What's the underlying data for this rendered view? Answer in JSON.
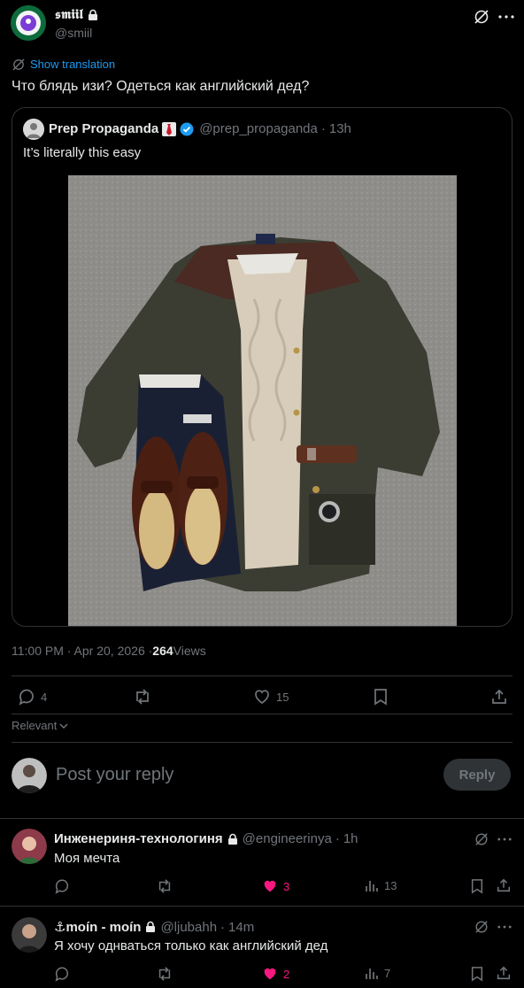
{
  "post": {
    "author_name": "𝖘𝖒𝖎𝖎𝖑",
    "author_handle": "@smiil",
    "translate_label": "Show translation",
    "text": "Что блядь изи? Одеться как английский дед?",
    "quote": {
      "author_name": "Prep Propaganda",
      "author_handle": "@prep_propaganda",
      "time": "13h",
      "text": "It’s literally this easy"
    },
    "timestamp": "11:00 PM · Apr 20, 2026 · ",
    "views_count": "264",
    "views_label": " Views",
    "stats": {
      "replies": "4",
      "reposts": "",
      "likes": "15"
    }
  },
  "sort": {
    "label": "Relevant"
  },
  "composer": {
    "placeholder": "Post your reply",
    "button": "Reply"
  },
  "replies": [
    {
      "name": "Инженериня-технологиня",
      "handle": "@engineerinya",
      "time": "1h",
      "text": "Моя мечта",
      "replies": "",
      "reposts": "",
      "likes": "3",
      "views": "13"
    },
    {
      "name": "⚓moín - moín",
      "handle": "@ljubahh",
      "time": "14m",
      "text": "Я хочу однваться только как английский дед",
      "replies": "",
      "reposts": "",
      "likes": "2",
      "views": "7"
    }
  ],
  "colors": {
    "accent": "#1d9bf0",
    "like": "#f91880",
    "border": "#2f3336",
    "muted": "#71767b"
  }
}
